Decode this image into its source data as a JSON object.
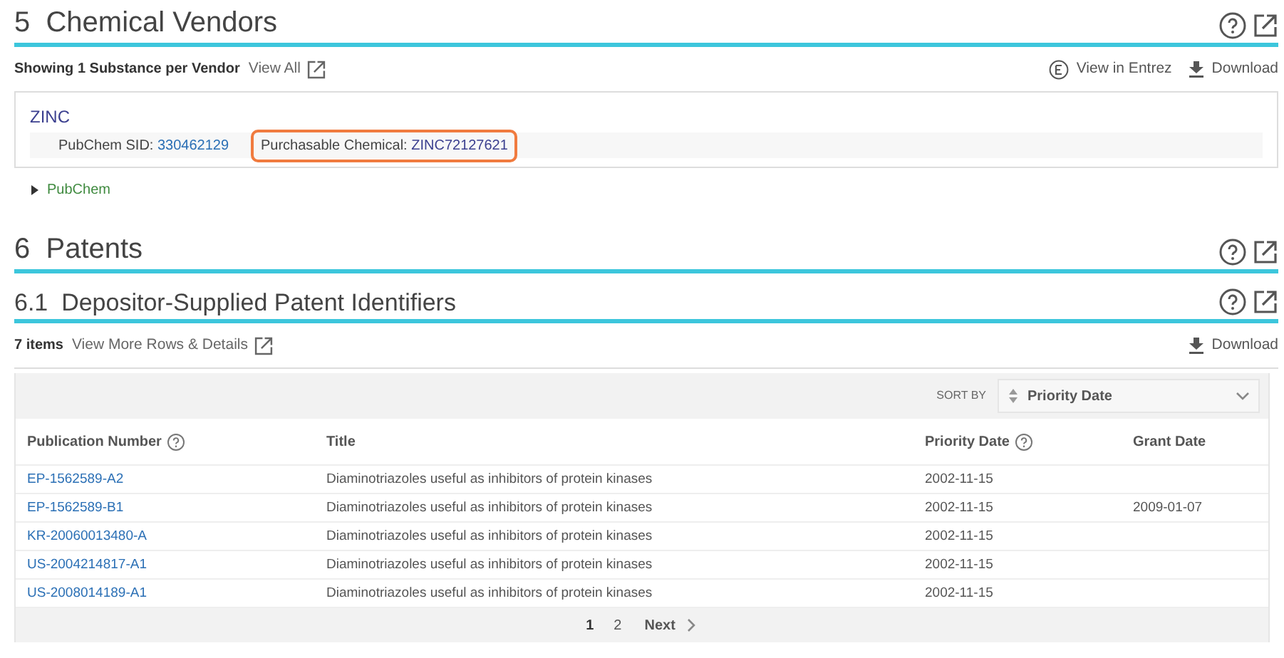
{
  "sections": [
    {
      "kind": "vendors",
      "number": "5",
      "title": "Chemical Vendors",
      "toolbar": {
        "summary": "Showing 1 Substance per Vendor",
        "view_link": "View All",
        "actions": [
          {
            "kind": "entrez",
            "label": "View in Entrez"
          },
          {
            "kind": "download",
            "label": "Download"
          }
        ]
      },
      "vendor": {
        "name": "ZINC",
        "sid_label": "PubChem SID:",
        "sid": "330462129",
        "chem_label": "Purchasable Chemical:",
        "chem_id": "ZINC72127621",
        "highlighted": true
      },
      "source": {
        "label": "PubChem",
        "expanded": false
      }
    },
    {
      "kind": "heading",
      "number": "6",
      "title": "Patents"
    },
    {
      "kind": "table",
      "number": "6.1",
      "title": "Depositor-Supplied Patent Identifiers",
      "toolbar": {
        "summary": "7 items",
        "view_link": "View More Rows & Details",
        "actions": [
          {
            "kind": "download",
            "label": "Download"
          }
        ]
      },
      "sort": {
        "label": "SORT BY",
        "value": "Priority Date"
      },
      "columns": [
        {
          "label": "Publication Number",
          "help": true
        },
        {
          "label": "Title",
          "help": false
        },
        {
          "label": "Priority Date",
          "help": true
        },
        {
          "label": "Grant Date",
          "help": false
        }
      ],
      "rows": [
        [
          "EP-1562589-A2",
          "Diaminotriazoles useful as inhibitors of protein kinases",
          "2002-11-15",
          ""
        ],
        [
          "EP-1562589-B1",
          "Diaminotriazoles useful as inhibitors of protein kinases",
          "2002-11-15",
          "2009-01-07"
        ],
        [
          "KR-20060013480-A",
          "Diaminotriazoles useful as inhibitors of protein kinases",
          "2002-11-15",
          ""
        ],
        [
          "US-2004214817-A1",
          "Diaminotriazoles useful as inhibitors of protein kinases",
          "2002-11-15",
          ""
        ],
        [
          "US-2008014189-A1",
          "Diaminotriazoles useful as inhibitors of protein kinases",
          "2002-11-15",
          ""
        ]
      ],
      "pages": [
        {
          "label": "1",
          "selected": true
        },
        {
          "label": "2",
          "selected": false
        }
      ],
      "next": "Next"
    }
  ]
}
